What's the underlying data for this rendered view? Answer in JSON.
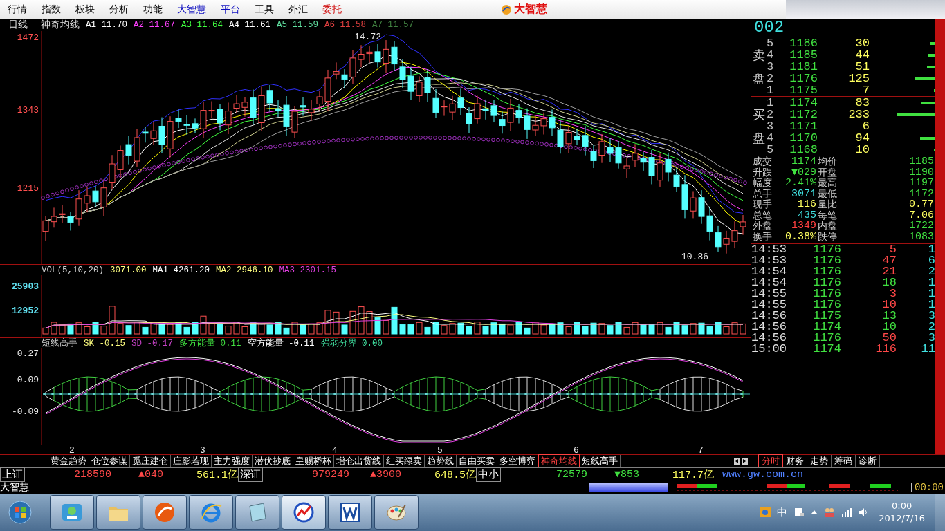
{
  "menu": [
    {
      "label": "行情"
    },
    {
      "label": "指数"
    },
    {
      "label": "板块"
    },
    {
      "label": "分析"
    },
    {
      "label": "功能"
    },
    {
      "label": "大智慧",
      "color": "#1010c0"
    },
    {
      "label": "平台",
      "color": "#1010c0"
    },
    {
      "label": "工具"
    },
    {
      "label": "外汇"
    },
    {
      "label": "委托",
      "color": "#d01010"
    }
  ],
  "app_logo": "大智慧",
  "price_chart": {
    "period": "日线",
    "indicator": "神奇均线",
    "lines": [
      {
        "label": "A1",
        "value": "11.70",
        "color": "#ffffff"
      },
      {
        "label": "A2",
        "value": "11.67",
        "color": "#ff40ff"
      },
      {
        "label": "A3",
        "value": "11.64",
        "color": "#40ff40"
      },
      {
        "label": "A4",
        "value": "11.61",
        "color": "#ffffff"
      },
      {
        "label": "A5",
        "value": "11.59",
        "color": "#60e0a0"
      },
      {
        "label": "A6",
        "value": "11.58",
        "color": "#e04040"
      },
      {
        "label": "A7",
        "value": "11.57",
        "color": "#408040"
      }
    ],
    "y_labels": [
      "1472",
      "1343",
      "1215"
    ],
    "high_label": "14.72",
    "low_label": "10.86"
  },
  "volume_chart": {
    "title": "VOL(5,10,20)",
    "lines": [
      {
        "value": "3071.00",
        "color": "#ffff80"
      },
      {
        "label": "MA1",
        "value": "4261.20",
        "color": "#ffffff"
      },
      {
        "label": "MA2",
        "value": "2946.10",
        "color": "#ffff80"
      },
      {
        "label": "MA3",
        "value": "2301.15",
        "color": "#e040e0"
      }
    ],
    "y_labels": [
      "25903",
      "12952"
    ]
  },
  "oscillator": {
    "name": "短线高手",
    "lines": [
      {
        "label": "SK",
        "value": "-0.15",
        "color": "#ffff80"
      },
      {
        "label": "SD",
        "value": "-0.17",
        "color": "#c040c0"
      },
      {
        "label": "多方能量",
        "value": "0.11",
        "color": "#40e040"
      },
      {
        "label": "空方能量",
        "value": "-0.11",
        "color": "#ffffff"
      },
      {
        "label": "强弱分界",
        "value": "0.00",
        "color": "#40e0a0"
      }
    ],
    "y_labels": [
      "0.27",
      "0.09",
      "-0.09"
    ]
  },
  "x_labels": [
    "2",
    "3",
    "4",
    "5",
    "6",
    "7"
  ],
  "quote": {
    "code": "002",
    "sell_label": "卖盘",
    "buy_label": "买盘",
    "sell": [
      {
        "num": "5",
        "price": "1186",
        "volume": "30"
      },
      {
        "num": "4",
        "price": "1185",
        "volume": "44"
      },
      {
        "num": "3",
        "price": "1181",
        "volume": "51"
      },
      {
        "num": "2",
        "price": "1176",
        "volume": "125"
      },
      {
        "num": "1",
        "price": "1175",
        "volume": "7"
      }
    ],
    "buy": [
      {
        "num": "1",
        "price": "1174",
        "volume": "83"
      },
      {
        "num": "2",
        "price": "1172",
        "volume": "233"
      },
      {
        "num": "3",
        "price": "1171",
        "volume": "6"
      },
      {
        "num": "4",
        "price": "1170",
        "volume": "94"
      },
      {
        "num": "5",
        "price": "1168",
        "volume": "10"
      }
    ],
    "stats": [
      {
        "label": "成交",
        "value": "1174",
        "color": "#40e040"
      },
      {
        "label": "均价",
        "value": "1185",
        "color": "#40e040"
      },
      {
        "label": "升跌",
        "value": "▼029",
        "color": "#40e040"
      },
      {
        "label": "开盘",
        "value": "1190",
        "color": "#40e040"
      },
      {
        "label": "幅度",
        "value": "2.41%",
        "color": "#40e040"
      },
      {
        "label": "最高",
        "value": "1197",
        "color": "#40e040"
      },
      {
        "label": "总手",
        "value": "3071",
        "color": "#40e0e0"
      },
      {
        "label": "最低",
        "value": "1172",
        "color": "#40e040"
      },
      {
        "label": "现手",
        "value": "116",
        "color": "#ffff60"
      },
      {
        "label": "量比",
        "value": "0.77",
        "color": "#ffff60"
      },
      {
        "label": "总笔",
        "value": "435",
        "color": "#40e0e0"
      },
      {
        "label": "每笔",
        "value": "7.06",
        "color": "#ffff60"
      },
      {
        "label": "外盘",
        "value": "1349",
        "color": "#ff4040"
      },
      {
        "label": "内盘",
        "value": "1722",
        "color": "#40e040"
      },
      {
        "label": "换手",
        "value": "0.38%",
        "color": "#ffff60"
      },
      {
        "label": "跌停",
        "value": "1083",
        "color": "#40e040"
      }
    ],
    "ticks": [
      {
        "time": "14:53",
        "price": "1176",
        "volume": "5",
        "color": "#ff4848",
        "count": "1"
      },
      {
        "time": "14:53",
        "price": "1176",
        "volume": "47",
        "color": "#ff4848",
        "count": "6"
      },
      {
        "time": "14:54",
        "price": "1176",
        "volume": "21",
        "color": "#ff4848",
        "count": "2"
      },
      {
        "time": "14:54",
        "price": "1176",
        "volume": "18",
        "color": "#40e040",
        "count": "1"
      },
      {
        "time": "14:55",
        "price": "1176",
        "volume": "3",
        "color": "#ff4848",
        "count": "1"
      },
      {
        "time": "14:55",
        "price": "1176",
        "volume": "10",
        "color": "#ff4848",
        "count": "1"
      },
      {
        "time": "14:56",
        "price": "1175",
        "volume": "13",
        "color": "#40e040",
        "count": "3"
      },
      {
        "time": "14:56",
        "price": "1174",
        "volume": "10",
        "color": "#40e040",
        "count": "2"
      },
      {
        "time": "14:56",
        "price": "1176",
        "volume": "50",
        "color": "#ff4848",
        "count": "3"
      },
      {
        "time": "15:00",
        "price": "1174",
        "volume": "116",
        "color": "#ff4848",
        "count": "11"
      }
    ]
  },
  "bottom_tabs": [
    {
      "label": "黄金趋势",
      "selected": false
    },
    {
      "label": "仓位参谋",
      "selected": false
    },
    {
      "label": "觅庄建仓",
      "selected": false
    },
    {
      "label": "庄影若现",
      "selected": false
    },
    {
      "label": "主力强度",
      "selected": false
    },
    {
      "label": "潜伏抄底",
      "selected": false
    },
    {
      "label": "皇赐桥杯",
      "selected": false
    },
    {
      "label": "增仓出货线",
      "selected": false
    },
    {
      "label": "红买绿卖",
      "selected": false
    },
    {
      "label": "趋势线",
      "selected": false
    },
    {
      "label": "自由买卖",
      "selected": false
    },
    {
      "label": "多空博弈",
      "selected": false
    },
    {
      "label": "神奇均线",
      "selected": true
    },
    {
      "label": "短线高手",
      "selected": false
    }
  ],
  "side_tabs": [
    {
      "label": "分时",
      "selected": true
    },
    {
      "label": "财务",
      "selected": false
    },
    {
      "label": "走势",
      "selected": false
    },
    {
      "label": "筹码",
      "selected": false
    },
    {
      "label": "诊断",
      "selected": false
    }
  ],
  "index_bar": [
    {
      "name": "上证",
      "value": "218590",
      "change": "▲040",
      "amount": "561.1亿",
      "color": "#ff4848"
    },
    {
      "name": "深证",
      "value": "979249",
      "change": "▲3900",
      "amount": "648.5亿",
      "color": "#ff4848"
    },
    {
      "name": "中小",
      "value": "72579",
      "change": "▼853",
      "amount": "117.7亿",
      "color": "#40e040"
    }
  ],
  "site": "www.gw.com.cn",
  "status": {
    "label": "大智慧",
    "time": "00:00"
  },
  "taskbar": {
    "ime": "中",
    "clock_time": "0:00",
    "clock_date": "2012/7/16"
  }
}
